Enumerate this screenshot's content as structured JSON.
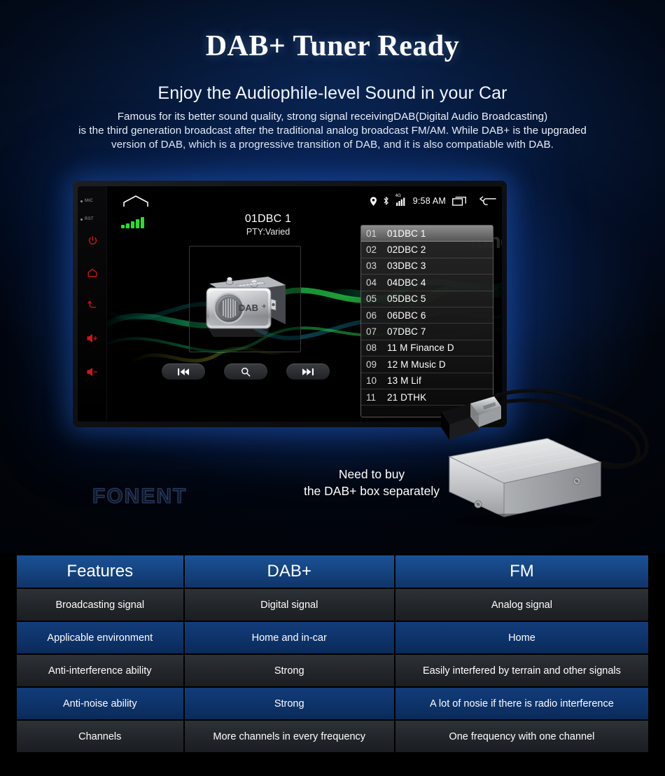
{
  "header": {
    "title": "DAB+ Tuner Ready",
    "subtitle": "Enjoy the Audiophile-level Sound in your Car",
    "paragraph_line1": "Famous for its better sound quality, strong signal receivingDAB(Digital Audio Broadcasting)",
    "paragraph_line2": "is the third generation broadcast after the traditional analog broadcast FM/AM. While DAB+ is the upgraded",
    "paragraph_line3": "version of DAB, which is a progressive transition of DAB, and it is also compatiable with DAB."
  },
  "watermarks": {
    "brand_outline": "FONENT",
    "screen_overlay": "fongent"
  },
  "head_unit": {
    "hard_keys": {
      "mic_label": "MIC",
      "rst_label": "RST",
      "icons": [
        "power-icon",
        "home-icon",
        "back-icon",
        "volume-up-icon",
        "volume-down-icon"
      ]
    },
    "status_bar": {
      "icons": [
        "location-pin-icon",
        "bluetooth-icon",
        "cellular-4g-icon",
        "recent-apps-icon",
        "back-arrow-icon"
      ],
      "time": "9:58 AM",
      "network_label": "4G"
    },
    "now_playing": {
      "station": "01DBC 1",
      "pty": "PTY:Varied",
      "album_art_label": "DAB+",
      "signal_bars": 5
    },
    "transport_controls": [
      {
        "name": "previous-button",
        "glyph": "prev"
      },
      {
        "name": "search-button",
        "glyph": "search"
      },
      {
        "name": "next-button",
        "glyph": "next"
      }
    ],
    "station_list": [
      {
        "index": "01",
        "name": "01DBC 1",
        "selected": true
      },
      {
        "index": "02",
        "name": "02DBC 2",
        "selected": false
      },
      {
        "index": "03",
        "name": "03DBC 3",
        "selected": false
      },
      {
        "index": "04",
        "name": "04DBC 4",
        "selected": false
      },
      {
        "index": "05",
        "name": "05DBC 5",
        "selected": false
      },
      {
        "index": "06",
        "name": "06DBC 6",
        "selected": false
      },
      {
        "index": "07",
        "name": "07DBC 7",
        "selected": false
      },
      {
        "index": "08",
        "name": "11 M Finance D",
        "selected": false
      },
      {
        "index": "09",
        "name": "12 M Music D",
        "selected": false
      },
      {
        "index": "10",
        "name": "13 M Lif",
        "selected": false
      },
      {
        "index": "11",
        "name": "21 DTHK",
        "selected": false
      }
    ]
  },
  "accessory_note": {
    "line1": "Need to buy",
    "line2": "the DAB+ box separately"
  },
  "comparison_table": {
    "headers": [
      "Features",
      "DAB+",
      "FM"
    ],
    "rows": [
      {
        "feature": "Broadcasting signal",
        "dab": "Digital signal",
        "fm": "Analog signal",
        "style": "dark"
      },
      {
        "feature": "Applicable environment",
        "dab": "Home and in-car",
        "fm": "Home",
        "style": "blue"
      },
      {
        "feature": "Anti-interference ability",
        "dab": "Strong",
        "fm": "Easily interfered by terrain and other signals",
        "style": "dark"
      },
      {
        "feature": "Anti-noise ability",
        "dab": "Strong",
        "fm": "A lot of nosie if there is radio interference",
        "style": "blue"
      },
      {
        "feature": "Channels",
        "dab": "More channels in every frequency",
        "fm": "One frequency with one channel",
        "style": "dark"
      }
    ]
  },
  "colors": {
    "accent_blue": "#1b5196",
    "row_dark": "#262a2e",
    "row_blue": "#0d3a75",
    "signal_green": "#25e02a",
    "hardkey_red": "#d01515"
  }
}
